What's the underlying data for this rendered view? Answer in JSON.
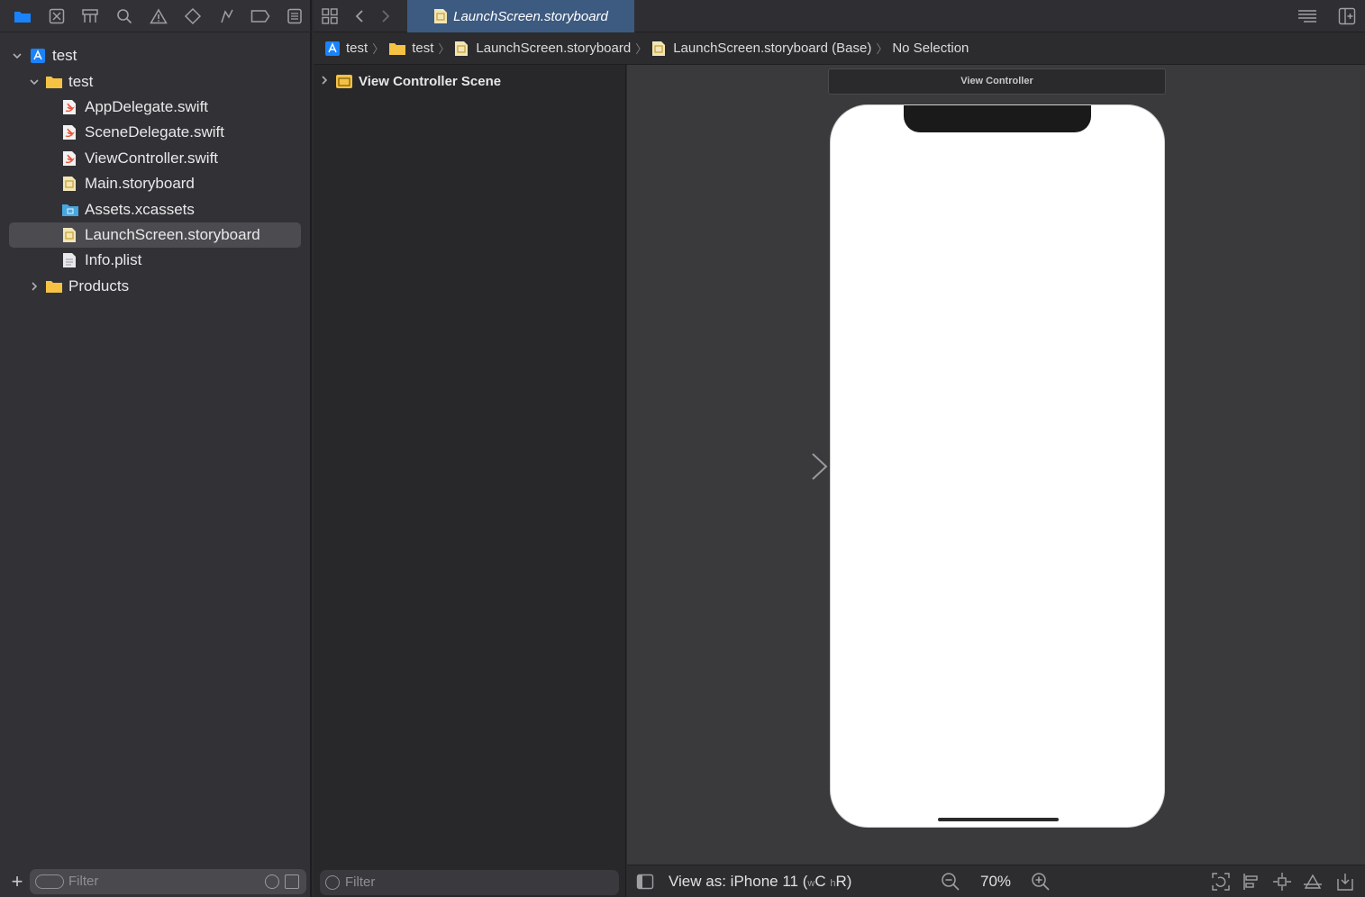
{
  "toolbar": {
    "tab_title": "LaunchScreen.storyboard"
  },
  "navigator": {
    "tree": [
      {
        "label": "test",
        "icon": "project-icon",
        "level": 0,
        "expanded": true
      },
      {
        "label": "test",
        "icon": "folder-icon",
        "level": 1,
        "expanded": true
      },
      {
        "label": "AppDelegate.swift",
        "icon": "swift-file-icon",
        "level": 2
      },
      {
        "label": "SceneDelegate.swift",
        "icon": "swift-file-icon",
        "level": 2
      },
      {
        "label": "ViewController.swift",
        "icon": "swift-file-icon",
        "level": 2
      },
      {
        "label": "Main.storyboard",
        "icon": "storyboard-file-icon",
        "level": 2
      },
      {
        "label": "Assets.xcassets",
        "icon": "assets-folder-icon",
        "level": 2
      },
      {
        "label": "LaunchScreen.storyboard",
        "icon": "storyboard-file-icon",
        "level": 2,
        "selected": true
      },
      {
        "label": "Info.plist",
        "icon": "plist-file-icon",
        "level": 2
      },
      {
        "label": "Products",
        "icon": "folder-icon",
        "level": 1,
        "expanded": false
      }
    ],
    "filter_placeholder": "Filter"
  },
  "jumpbar": {
    "crumbs": [
      "test",
      "test",
      "LaunchScreen.storyboard",
      "LaunchScreen.storyboard (Base)",
      "No Selection"
    ]
  },
  "outline": {
    "scene_label": "View Controller Scene",
    "filter_placeholder": "Filter"
  },
  "canvas": {
    "vc_title": "View Controller"
  },
  "bottom_bar": {
    "view_as_prefix": "View as: iPhone 11 (",
    "w_small": "w",
    "w_big": "C",
    "h_small": "h",
    "h_big": "R",
    "view_as_suffix": ")",
    "zoom": "70%"
  },
  "colors": {
    "accent": "#1a82fb",
    "folder": "#f5c243",
    "swift": "#e8533b",
    "selected_tab": "#3d5a80"
  }
}
